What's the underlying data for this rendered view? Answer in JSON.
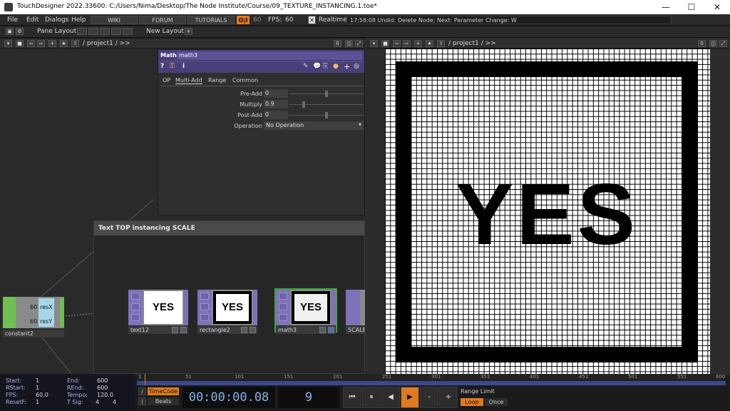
{
  "window": {
    "title": "TouchDesigner 2022.33600: C:/Users/Nima/Desktop/The Node Institute/Course/09_TEXTURE_INSTANCING.1.toe*",
    "minimize": "—",
    "maximize": "☐",
    "close": "✕"
  },
  "menubar": {
    "items": [
      "File",
      "Edit",
      "Dialogs",
      "Help"
    ],
    "wiki": "WIKI",
    "forum": "FORUM",
    "tutorials": "TUTORIALS",
    "oi": "O|I",
    "fps_target": "60",
    "fps_label": "FPS:",
    "fps_value": "60",
    "realtime_label": "Realtime",
    "status": "17:58:08 Undid: Delete Node; Next: Parameter Change: W"
  },
  "toolbar2": {
    "pane_layout": "Pane Layout",
    "new_layout": "New Layout"
  },
  "network_pane": {
    "path": "/ project1 / >>",
    "zero": "0"
  },
  "viewer_pane": {
    "path": "/ project1 / >>",
    "zero": "0"
  },
  "param": {
    "type": "Math",
    "name": "math3",
    "tabs": [
      "OP",
      "Multi-Add",
      "Range",
      "Common"
    ],
    "active_tab": "Multi-Add",
    "rows": [
      {
        "label": "Pre-Add",
        "value": "0"
      },
      {
        "label": "Multiply",
        "value": "0.9"
      },
      {
        "label": "Post-Add",
        "value": "0"
      }
    ],
    "operation_label": "Operation",
    "operation_value": "No Operation"
  },
  "annotation": {
    "title": "Text TOP instancing SCALE"
  },
  "nodes": [
    {
      "name": "text12",
      "thumb": "YES"
    },
    {
      "name": "rectangle2",
      "thumb": "YES"
    },
    {
      "name": "math3",
      "thumb": "YES"
    },
    {
      "name": "SCALE",
      "thumb": ""
    }
  ],
  "constant_node": {
    "name": "constant2",
    "res_x_value": "60",
    "res_x_label": "resX",
    "res_y_value": "60",
    "res_y_label": "resY"
  },
  "viewer": {
    "text": "YES"
  },
  "timeline": {
    "start_label": "Start:",
    "start": "1",
    "rstart_label": "RStart:",
    "rstart": "1",
    "fps_label": "FPS:",
    "fps": "60.0",
    "resetf_label": "ResetF:",
    "resetf": "1",
    "end_label": "End:",
    "end": "600",
    "rend_label": "REnd:",
    "rend": "600",
    "tempo_label": "Tempo:",
    "tempo": "120.0",
    "tsig_label": "T Sig:",
    "tsig_a": "4",
    "tsig_b": "4",
    "ticks": [
      "1",
      "51",
      "101",
      "151",
      "201",
      "251",
      "301",
      "351",
      "401",
      "451",
      "501",
      "551",
      "600"
    ],
    "timecode_btn": "TimeCode",
    "beats_btn": "Beats",
    "timecode": "00:00:00.08",
    "frame": "9",
    "range_limit": "Range Limit",
    "loop": "Loop",
    "once": "Once"
  }
}
